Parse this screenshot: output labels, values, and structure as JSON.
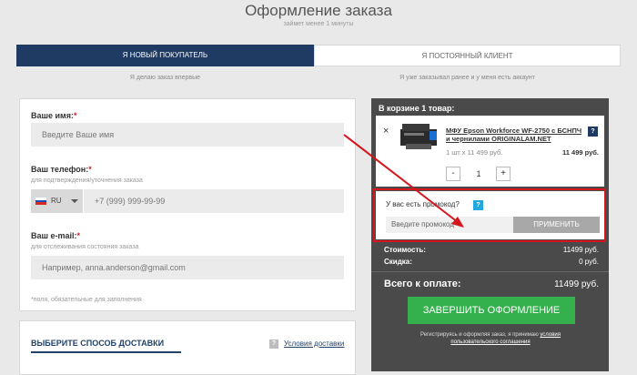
{
  "header": {
    "title": "Оформление заказа",
    "subtitle": "займет менее 1 минуты"
  },
  "tabs": [
    {
      "label": "Я НОВЫЙ ПОКУПАТЕЛЬ",
      "note": "Я делаю заказ впервые",
      "active": true
    },
    {
      "label": "Я ПОСТОЯННЫЙ КЛИЕНТ",
      "note": "Я уже заказывал ранее и у меня есть аккаунт",
      "active": false
    }
  ],
  "form": {
    "name": {
      "label": "Ваше имя:",
      "required": "*",
      "placeholder": "Введите Ваше имя"
    },
    "phone": {
      "label": "Ваш телефон:",
      "required": "*",
      "hint": "для подтверждения/уточнения заказа",
      "country": "RU",
      "placeholder": "+7 (999) 999-99-99"
    },
    "email": {
      "label": "Ваш e-mail:",
      "required": "*",
      "hint": "для отслеживания состояния заказа",
      "placeholder": "Например, anna.anderson@gmail.com"
    },
    "footnote": "*поля, обязательные для заполнения"
  },
  "delivery": {
    "title": "ВЫБЕРИТЕ СПОСОБ ДОСТАВКИ",
    "help": "?",
    "link": "Условия доставки"
  },
  "cart": {
    "heading": "В корзине 1 товар:",
    "item": {
      "remove": "×",
      "name": "МФУ Epson Workforce WF-2750 с БСНПЧ и чернилами ORIGINALAM.NET",
      "help": "?",
      "meta": "1 шт x 11 499 руб.",
      "total": "11 499 руб.",
      "qty": "1",
      "minus": "-",
      "plus": "+"
    },
    "promo": {
      "question": "У вас есть промокод?",
      "help": "?",
      "placeholder": "Введите промокод",
      "button": "ПРИМЕНИТЬ"
    },
    "cost_label": "Стоимость:",
    "cost_value": "11499 руб.",
    "discount_label": "Скидка:",
    "discount_value": "0 руб.",
    "total_label": "Всего к оплате:",
    "total_value": "11499 руб.",
    "checkout": "ЗАВЕРШИТЬ ОФОРМЛЕНИЕ",
    "legal_text": "Регистрируясь и оформляя заказ, я принимаю",
    "legal_link_1": "условия",
    "legal_link_2": "пользовательского соглашения"
  },
  "colors": {
    "tab_active": "#1f3a63",
    "checkout": "#34b04d",
    "annotation": "#d4161d",
    "cart_bg": "#4a4a4a"
  }
}
